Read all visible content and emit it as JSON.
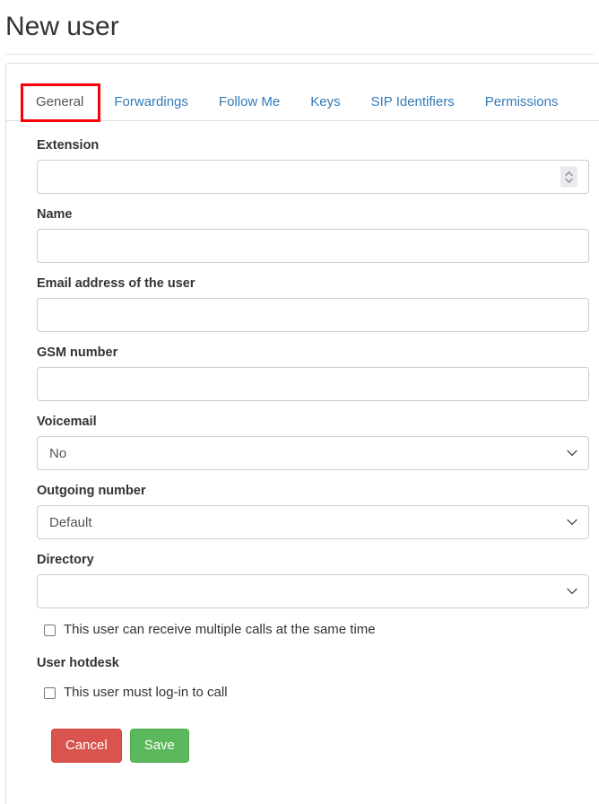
{
  "page": {
    "title": "New user"
  },
  "tabs": [
    {
      "label": "General",
      "active": true
    },
    {
      "label": "Forwardings",
      "active": false
    },
    {
      "label": "Follow Me",
      "active": false
    },
    {
      "label": "Keys",
      "active": false
    },
    {
      "label": "SIP Identifiers",
      "active": false
    },
    {
      "label": "Permissions",
      "active": false
    }
  ],
  "form": {
    "extension": {
      "label": "Extension",
      "value": "",
      "placeholder": ""
    },
    "name": {
      "label": "Name",
      "value": "",
      "placeholder": ""
    },
    "email": {
      "label": "Email address of the user",
      "value": "",
      "placeholder": ""
    },
    "gsm": {
      "label": "GSM number",
      "value": "",
      "placeholder": ""
    },
    "voicemail": {
      "label": "Voicemail",
      "value": "No"
    },
    "outgoing": {
      "label": "Outgoing number",
      "value": "Default"
    },
    "directory": {
      "label": "Directory",
      "value": ""
    },
    "multiple_calls": {
      "label": "This user can receive multiple calls at the same time",
      "checked": false
    },
    "hotdesk_heading": "User hotdesk",
    "hotdesk_login": {
      "label": "This user must log-in to call",
      "checked": false
    }
  },
  "buttons": {
    "cancel": "Cancel",
    "save": "Save"
  },
  "colors": {
    "link": "#337ab7",
    "highlight": "#fb0007",
    "cancel": "#d9534f",
    "save": "#5cb85c"
  }
}
